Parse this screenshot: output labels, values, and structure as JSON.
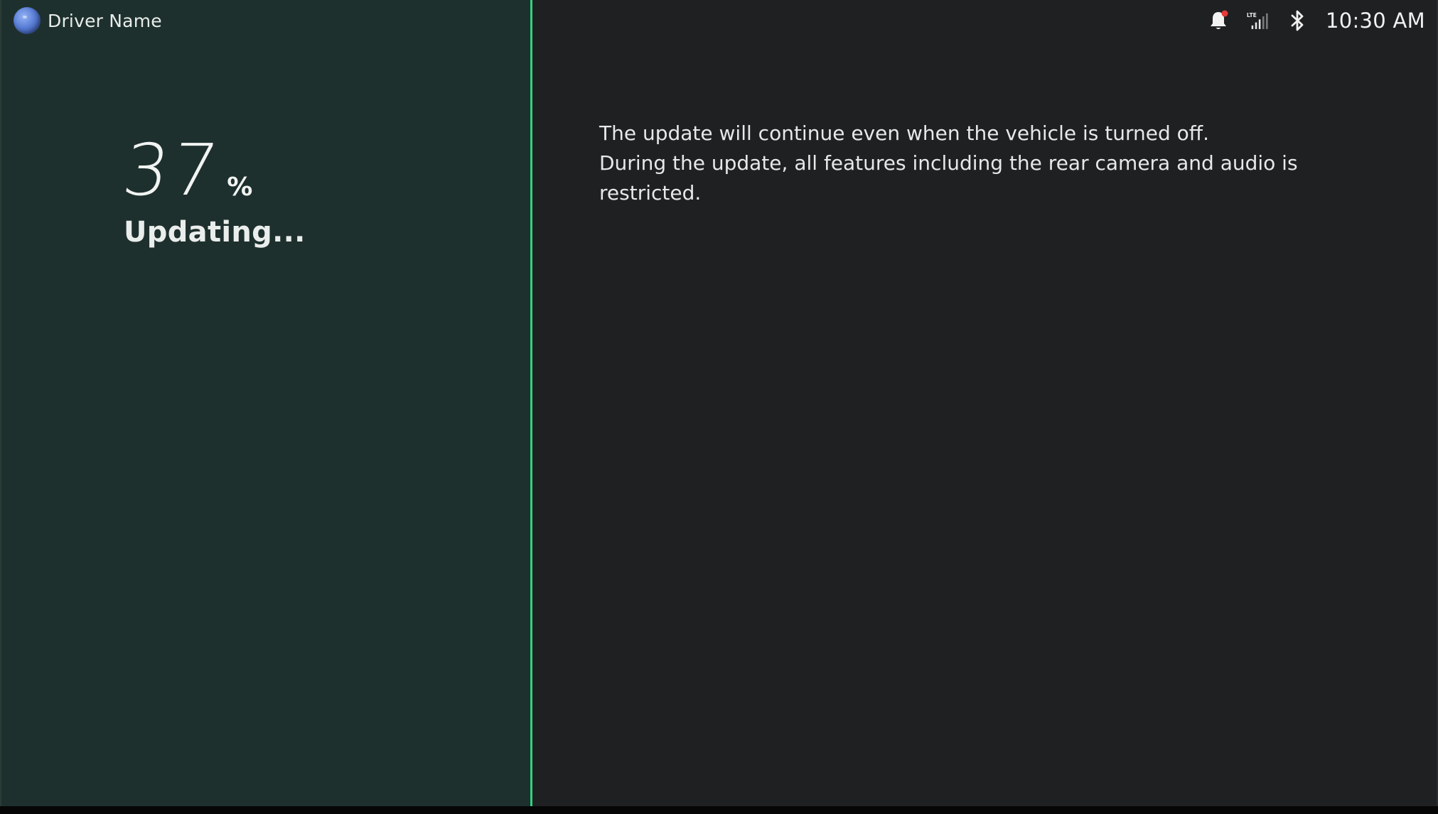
{
  "status_bar": {
    "driver_name": "Driver Name",
    "time": "10:30 AM",
    "icons": {
      "notification": "bell-icon",
      "signal": "signal-strength-icon",
      "bluetooth": "bluetooth-icon"
    },
    "notification_dot_color": "#e5393a"
  },
  "update": {
    "progress_value": "37",
    "progress_unit": "%",
    "progress_percent": 37,
    "status_label": "Updating...",
    "message_lines": [
      "The update will continue even when the vehicle is turned off.",
      "During the update, all features including the rear camera and audio is restricted."
    ]
  },
  "colors": {
    "left_panel_bg": "#1e302d",
    "right_panel_bg": "#1f2022",
    "accent_divider": "#2ed483",
    "text_primary": "#f1f4f2"
  }
}
